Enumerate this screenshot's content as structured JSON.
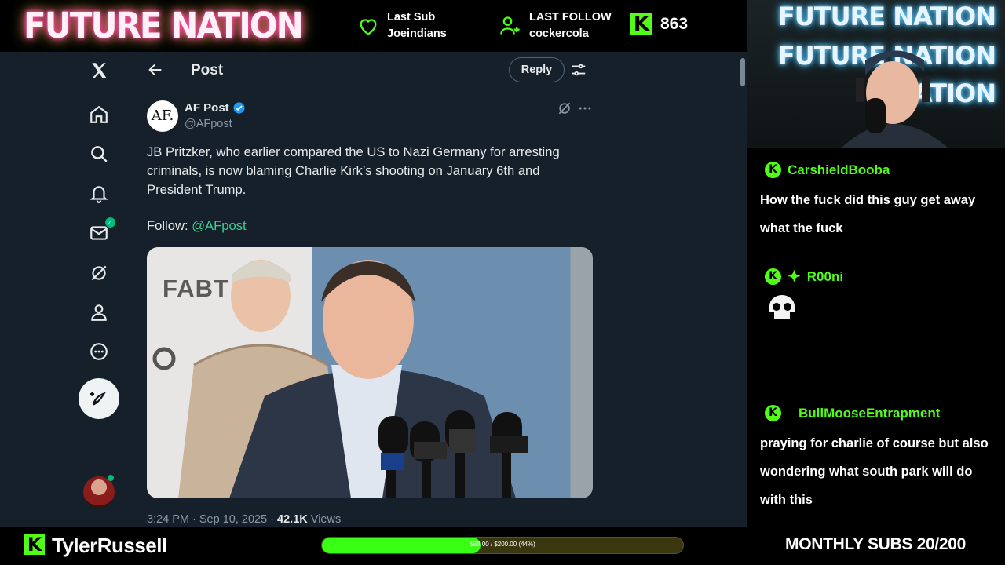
{
  "overlay": {
    "logo": "FUTURE NATION",
    "last_sub_label": "Last Sub",
    "last_sub_name": "Joeindians",
    "last_follow_label": "LAST FOLLOW",
    "last_follow_name": "cockercola",
    "kick_count": "863",
    "kick_glyph": "K"
  },
  "x": {
    "header_title": "Post",
    "reply_label": "Reply",
    "messages_badge": "4",
    "tweet": {
      "author_avatar_text": "AF.",
      "author_name": "AF Post",
      "author_handle": "@AFpost",
      "text": "JB Pritzker, who earlier compared the US to Nazi Germany for arresting criminals, is now blaming Charlie Kirk’s shooting on January 6th and President Trump.",
      "follow_label": "Follow:",
      "follow_mention": "@AFpost",
      "media_text": "FABT",
      "time": "3:24 PM · Sep 10, 2025 · ",
      "views_count": "42.1K",
      "views_label": " Views"
    }
  },
  "webcam": {
    "neon_lines": [
      "FUTURE NATION",
      "FUTURE NATION",
      "NATION"
    ]
  },
  "chat": {
    "messages": [
      {
        "user": "CarshieldBooba",
        "text": "How the fuck did this guy get away what the fuck"
      },
      {
        "user": "R00ni",
        "text": ""
      },
      {
        "user": "BullMooseEntrapment",
        "text": "praying for charlie of course but also wondering what south park will do with this"
      }
    ]
  },
  "bottom": {
    "streamer": "TylerRussell",
    "progress_text": "$88.00 / $200.00 (44%)",
    "progress_fraction": 0.44,
    "monthly_subs": "MONTHLY SUBS 20/200"
  },
  "colors": {
    "kick_green": "#53fc18",
    "x_bg": "#15202b",
    "x_border": "#38444d",
    "verified": "#1d9bf0"
  }
}
